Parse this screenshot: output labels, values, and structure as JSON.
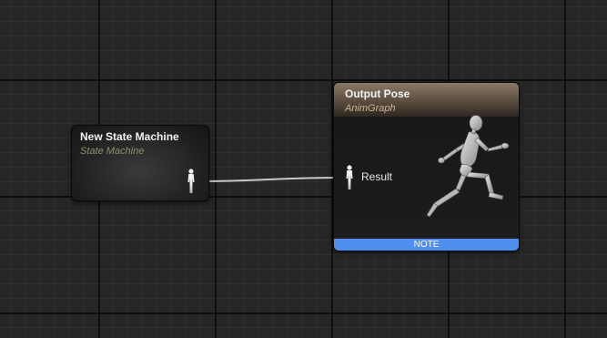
{
  "nodes": {
    "state_machine": {
      "title": "New State Machine",
      "subtitle": "State Machine",
      "pin_icon": "pose-pin-icon"
    },
    "output_pose": {
      "title": "Output Pose",
      "subtitle": "AnimGraph",
      "pin_label": "Result",
      "pin_icon": "pose-pin-icon",
      "preview_icon": "running-mannequin-icon",
      "note_label": "NOTE"
    }
  },
  "colors": {
    "graph_background": "#262626",
    "output_header": "#7a6a58",
    "note_bar": "#4f8fef",
    "wire": "#c8c8c8"
  }
}
